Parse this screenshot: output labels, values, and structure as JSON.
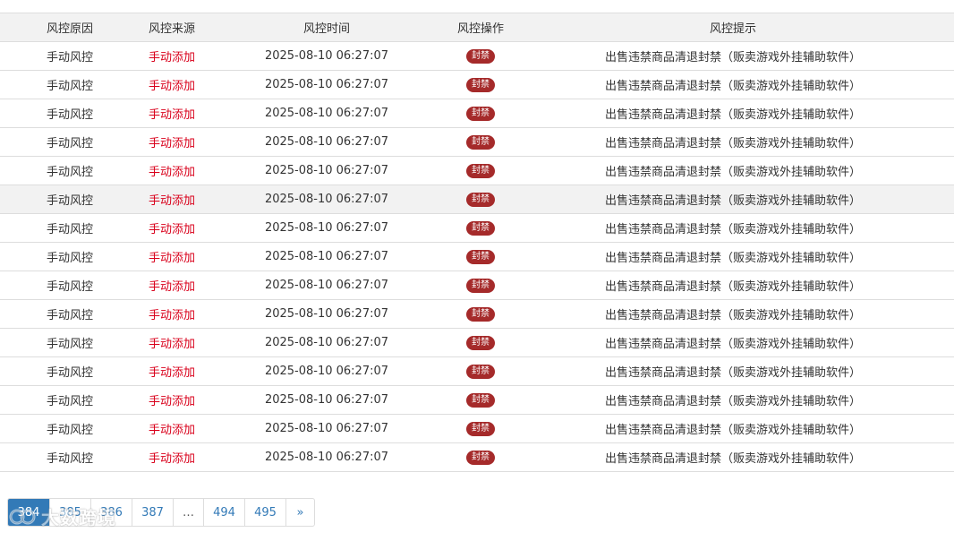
{
  "table": {
    "headers": [
      "风控原因",
      "风控来源",
      "风控时间",
      "风控操作",
      "风控提示"
    ],
    "rows": [
      {
        "reason": "手动风控",
        "source": "手动添加",
        "time": "2025-08-10 06:27:07",
        "action": "封禁",
        "tip": "出售违禁商品清退封禁（贩卖游戏外挂辅助软件）"
      },
      {
        "reason": "手动风控",
        "source": "手动添加",
        "time": "2025-08-10 06:27:07",
        "action": "封禁",
        "tip": "出售违禁商品清退封禁（贩卖游戏外挂辅助软件）"
      },
      {
        "reason": "手动风控",
        "source": "手动添加",
        "time": "2025-08-10 06:27:07",
        "action": "封禁",
        "tip": "出售违禁商品清退封禁（贩卖游戏外挂辅助软件）"
      },
      {
        "reason": "手动风控",
        "source": "手动添加",
        "time": "2025-08-10 06:27:07",
        "action": "封禁",
        "tip": "出售违禁商品清退封禁（贩卖游戏外挂辅助软件）"
      },
      {
        "reason": "手动风控",
        "source": "手动添加",
        "time": "2025-08-10 06:27:07",
        "action": "封禁",
        "tip": "出售违禁商品清退封禁（贩卖游戏外挂辅助软件）"
      },
      {
        "reason": "手动风控",
        "source": "手动添加",
        "time": "2025-08-10 06:27:07",
        "action": "封禁",
        "tip": "出售违禁商品清退封禁（贩卖游戏外挂辅助软件）"
      },
      {
        "reason": "手动风控",
        "source": "手动添加",
        "time": "2025-08-10 06:27:07",
        "action": "封禁",
        "tip": "出售违禁商品清退封禁（贩卖游戏外挂辅助软件）"
      },
      {
        "reason": "手动风控",
        "source": "手动添加",
        "time": "2025-08-10 06:27:07",
        "action": "封禁",
        "tip": "出售违禁商品清退封禁（贩卖游戏外挂辅助软件）"
      },
      {
        "reason": "手动风控",
        "source": "手动添加",
        "time": "2025-08-10 06:27:07",
        "action": "封禁",
        "tip": "出售违禁商品清退封禁（贩卖游戏外挂辅助软件）"
      },
      {
        "reason": "手动风控",
        "source": "手动添加",
        "time": "2025-08-10 06:27:07",
        "action": "封禁",
        "tip": "出售违禁商品清退封禁（贩卖游戏外挂辅助软件）"
      },
      {
        "reason": "手动风控",
        "source": "手动添加",
        "time": "2025-08-10 06:27:07",
        "action": "封禁",
        "tip": "出售违禁商品清退封禁（贩卖游戏外挂辅助软件）"
      },
      {
        "reason": "手动风控",
        "source": "手动添加",
        "time": "2025-08-10 06:27:07",
        "action": "封禁",
        "tip": "出售违禁商品清退封禁（贩卖游戏外挂辅助软件）"
      },
      {
        "reason": "手动风控",
        "source": "手动添加",
        "time": "2025-08-10 06:27:07",
        "action": "封禁",
        "tip": "出售违禁商品清退封禁（贩卖游戏外挂辅助软件）"
      },
      {
        "reason": "手动风控",
        "source": "手动添加",
        "time": "2025-08-10 06:27:07",
        "action": "封禁",
        "tip": "出售违禁商品清退封禁（贩卖游戏外挂辅助软件）"
      },
      {
        "reason": "手动风控",
        "source": "手动添加",
        "time": "2025-08-10 06:27:07",
        "action": "封禁",
        "tip": "出售违禁商品清退封禁（贩卖游戏外挂辅助软件）"
      }
    ],
    "highlighted_row": 5
  },
  "pagination": {
    "pages": [
      "384",
      "385",
      "386",
      "387",
      "…",
      "494",
      "495",
      "»"
    ],
    "active_index": 0
  },
  "watermark": {
    "text": "大数跨境",
    "icon": "watermark-logo-icon"
  },
  "colors": {
    "source_red": "#d9001b",
    "badge_bg": "#a52a2a",
    "header_bg": "#f2f2f2",
    "pager_active": "#337ab7"
  }
}
